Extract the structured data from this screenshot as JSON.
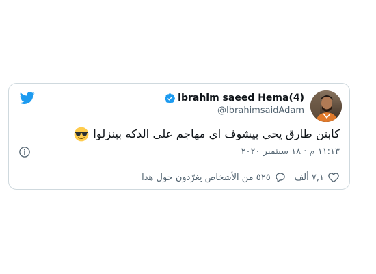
{
  "tweet": {
    "author": {
      "name": "ibrahim saeed Hema(4)",
      "handle": "@IbrahimsaidAdam",
      "verified": true
    },
    "text": "كابتن طارق يحي بيشوف اي مهاجم على الدكه بينزلوا",
    "emoji": "smiling-face-with-sunglasses",
    "timestamp": "١١:١٣ م · ١٨ سبتمبر ٢٠٢٠",
    "likes": "٧,١ ألف",
    "replies_label": "٥٢٥ من الأشخاص يغرّدون حول هذا"
  },
  "icons": {
    "brand": "twitter-bird-icon",
    "verified": "verified-badge-icon",
    "info": "info-icon",
    "like": "heart-icon",
    "reply": "speech-bubble-icon"
  },
  "colors": {
    "twitter_blue": "#1d9bf0",
    "text_primary": "#0f1419",
    "text_secondary": "#536471",
    "border": "#cfd9de"
  }
}
